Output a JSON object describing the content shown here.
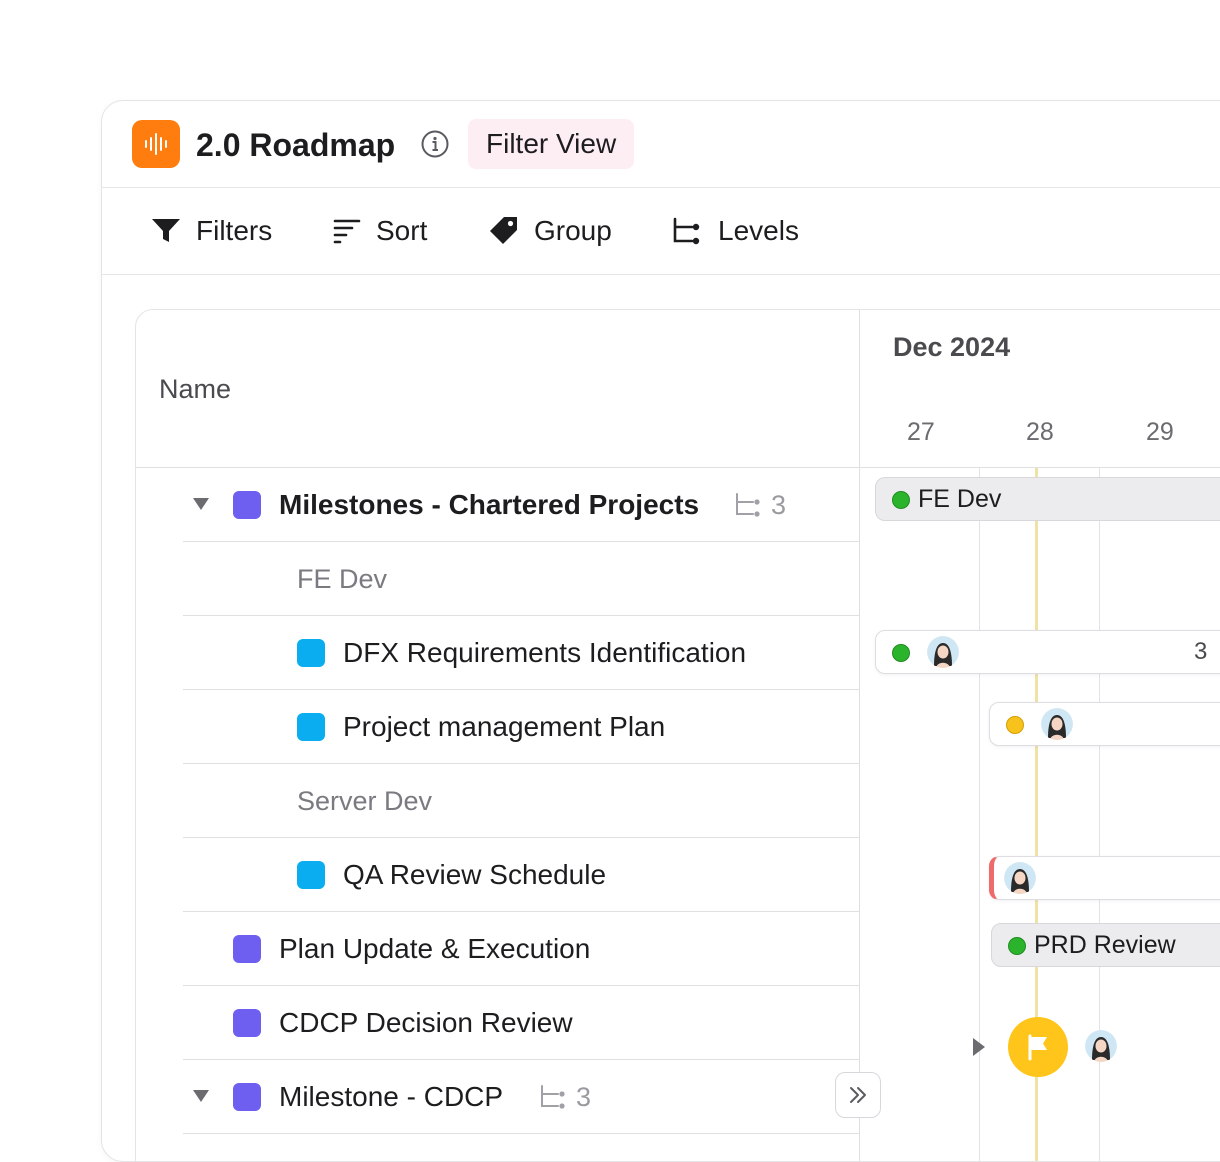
{
  "header": {
    "title": "2.0 Roadmap",
    "view_badge": "Filter View",
    "app_icon": "audio-waveform-icon",
    "accent_color": "#ff7d0f"
  },
  "toolbar": {
    "filters": "Filters",
    "sort": "Sort",
    "group": "Group",
    "levels": "Levels"
  },
  "table": {
    "name_header": "Name",
    "rows": [
      {
        "label": "Milestones - Chartered Projects",
        "kind": "parent",
        "color": "#6f5ff0",
        "count": "3",
        "expanded": true
      },
      {
        "label": "FE Dev",
        "kind": "group"
      },
      {
        "label": "DFX Requirements Identification",
        "kind": "child",
        "color": "#0aaef0"
      },
      {
        "label": "Project management Plan",
        "kind": "child",
        "color": "#0aaef0"
      },
      {
        "label": "Server Dev",
        "kind": "group"
      },
      {
        "label": "QA Review Schedule",
        "kind": "child",
        "color": "#0aaef0"
      },
      {
        "label": "Plan Update & Execution",
        "kind": "parent",
        "color": "#6f5ff0"
      },
      {
        "label": "CDCP Decision Review",
        "kind": "parent",
        "color": "#6f5ff0"
      },
      {
        "label": "Milestone - CDCP",
        "kind": "parent",
        "color": "#6f5ff0",
        "count": "3",
        "expanded": true
      }
    ]
  },
  "gantt": {
    "month": "Dec 2024",
    "days": [
      "27",
      "28",
      "29"
    ],
    "bars": [
      {
        "label": "FE Dev",
        "status_color": "#2cb32c"
      },
      {
        "label": "",
        "status_color": "#2cb32c",
        "count": "3"
      },
      {
        "label": "",
        "status_color": "#f7c21b"
      },
      {
        "label": "",
        "status_color": "#ef6b6b"
      },
      {
        "label": "PRD Review",
        "status_color": "#2cb32c"
      }
    ],
    "milestone_icon": "flag-icon",
    "milestone_color": "#ffc51a"
  }
}
